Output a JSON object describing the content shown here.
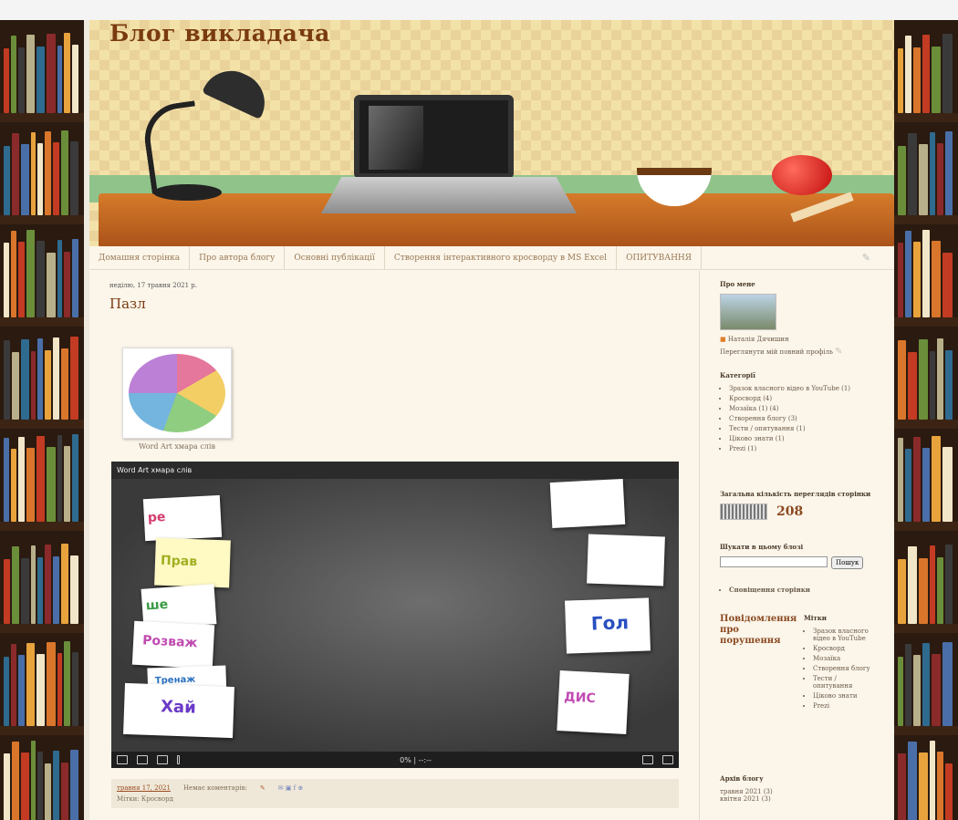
{
  "header": {
    "blog_title": "Блог викладача"
  },
  "nav": {
    "items": [
      "Домашня сторінка",
      "Про автора блогу",
      "Основні публікації",
      "Створення інтерактивного кросворду в MS Excel",
      "ОПИТУВАННЯ"
    ]
  },
  "post": {
    "date": "неділю, 17 травня 2021 р.",
    "title": "Пазл",
    "thumb_caption": "Word Art хмара слів",
    "player": {
      "title": "Word Art хмара слів",
      "progress": "0%",
      "time": "--:--"
    },
    "footer": {
      "posted_link": "травня 17, 2021",
      "comments": "Немає коментарів:",
      "labels": "Мітки: Кросворд"
    }
  },
  "sidebar": {
    "about_title": "Про мене",
    "author_name": "Наталія Дячишин",
    "profile_link": "Переглянути мій повний профіль",
    "categories_title": "Категорії",
    "categories": [
      "Зразок власного відео в YouTube (1)",
      "Кросворд (4)",
      "Мозаїка (1) (4)",
      "Створення блогу (3)",
      "Тести / опитування (1)",
      "Ціково знати (1)",
      "Prezi (1)"
    ],
    "views_title": "Загальна кількість переглядів сторінки",
    "views_count": "208",
    "search_title": "Шукати в цьому блозі",
    "search_button": "Пошук",
    "pages_item": "Сповіщення сторінки",
    "report_title": "Повідомлення про порушення",
    "labels_title": "Мітки",
    "labels": [
      "Зразок власного відео в YouTube",
      "Кросворд",
      "Мозаїка",
      "Створення блогу",
      "Тести / опитування",
      "Ціково знати",
      "Prezi"
    ],
    "archive_title": "Архів блогу",
    "archive": [
      "травня 2021 (3)",
      "квітня 2021 (3)"
    ]
  },
  "colors": {
    "title": "#7a3b10",
    "page_bg": "#fbf5ea",
    "desk": "#c0621f"
  }
}
